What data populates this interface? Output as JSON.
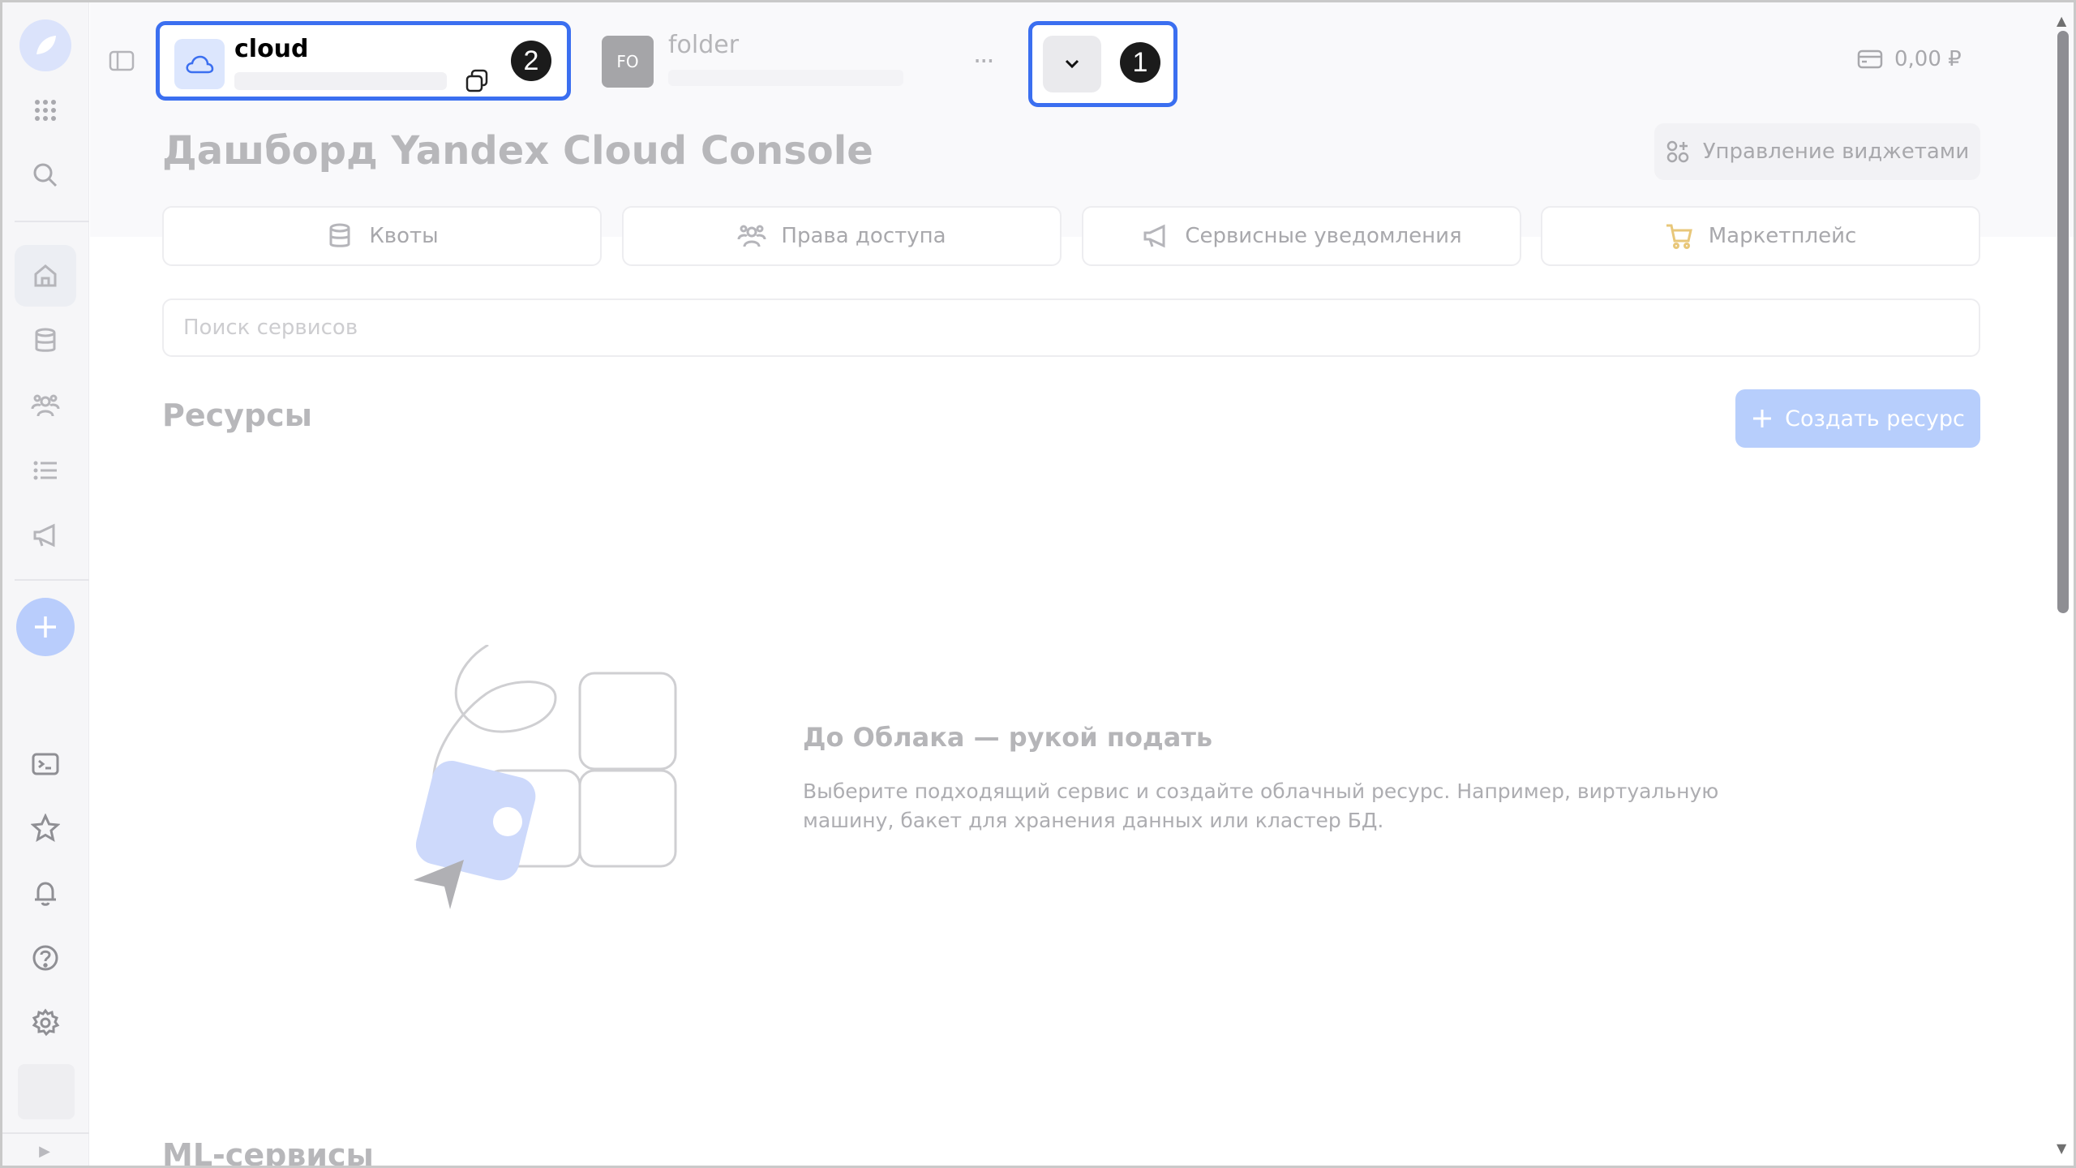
{
  "breadcrumbs": {
    "cloud": {
      "title": "cloud",
      "badge": "2"
    },
    "folder": {
      "avatar": "FO",
      "title": "folder"
    },
    "more": "···",
    "dropdown_badge": "1"
  },
  "header": {
    "balance": "0,00 ₽",
    "page_title": "Дашборд Yandex Cloud Console",
    "widgets_button": "Управление виджетами"
  },
  "quick_tabs": [
    {
      "label": "Квоты",
      "icon": "database-icon"
    },
    {
      "label": "Права доступа",
      "icon": "users-icon"
    },
    {
      "label": "Сервисные уведомления",
      "icon": "megaphone-icon"
    },
    {
      "label": "Маркетплейс",
      "icon": "cart-icon"
    }
  ],
  "search": {
    "placeholder": "Поиск сервисов"
  },
  "resources": {
    "title": "Ресурсы",
    "create_button": "Создать ресурс",
    "empty_title": "До Облака — рукой подать",
    "empty_description": "Выберите подходящий сервис и создайте облачный ресурс. Например, виртуальную машину, бакет для хранения данных или кластер БД."
  },
  "ml_section": {
    "title": "ML-сервисы"
  },
  "sidebar": {
    "items": [
      "logo-icon",
      "grid-icon",
      "search-icon",
      "home-icon",
      "database-icon",
      "users-icon",
      "list-icon",
      "megaphone-icon",
      "plus-icon",
      "terminal-icon",
      "star-icon",
      "bell-icon",
      "help-icon",
      "gear-icon"
    ],
    "expand_glyph": "▶"
  },
  "colors": {
    "accent": "#3b6ff0",
    "badge": "#1b1b1b",
    "create_button": "#b7cefc"
  }
}
